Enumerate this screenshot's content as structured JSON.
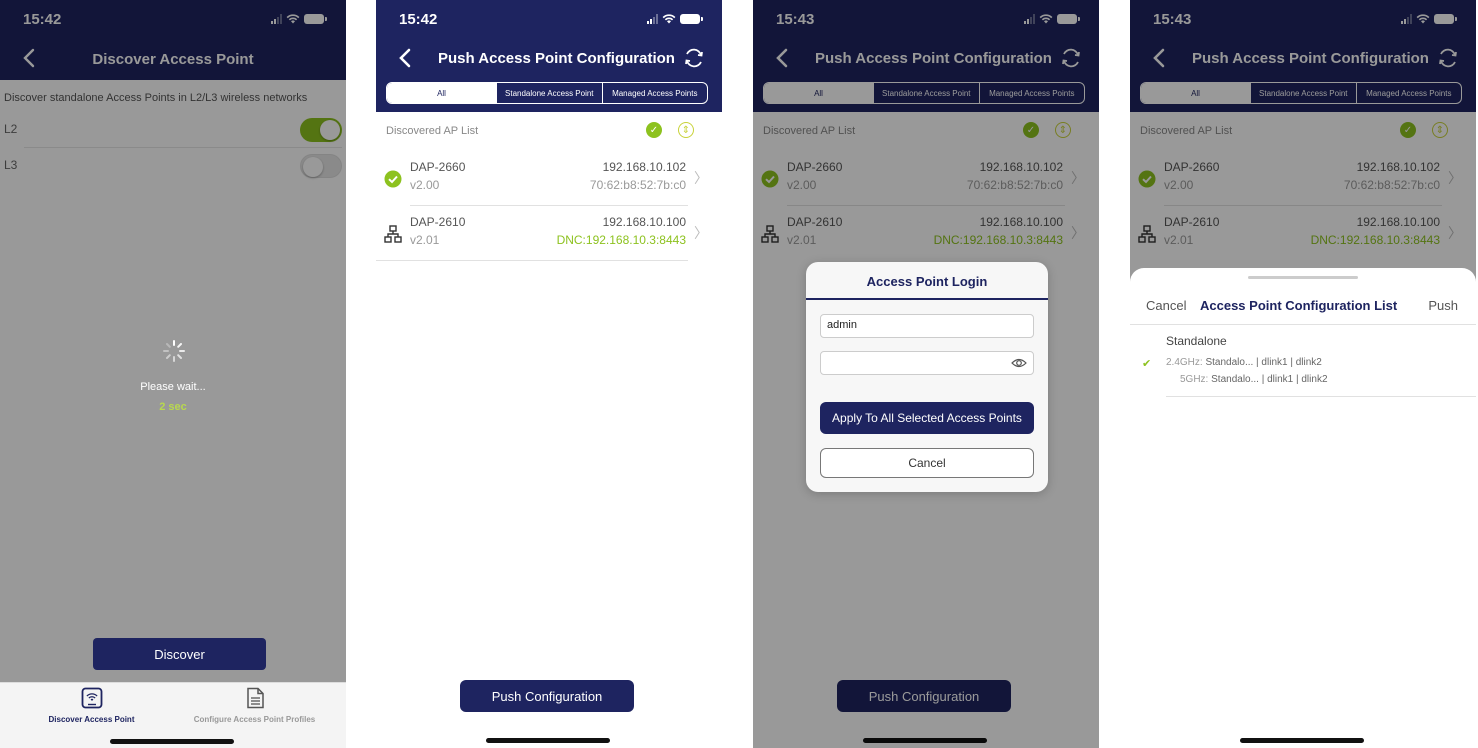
{
  "colors": {
    "navy": "#1e2460",
    "green": "#8dc21f",
    "gray_text": "#999999"
  },
  "screen1": {
    "time": "15:42",
    "title": "Discover Access Point",
    "description": "Discover standalone Access Points in L2/L3 wireless networks",
    "rows": [
      {
        "label": "L2",
        "on": true
      },
      {
        "label": "L3",
        "on": false
      }
    ],
    "wait_text": "Please wait...",
    "wait_seconds": "2 sec",
    "discover_label": "Discover",
    "tabs": [
      {
        "label": "Discover Access Point",
        "icon": "wifi-tablet-icon"
      },
      {
        "label": "Configure Access Point Profiles",
        "icon": "document-icon"
      }
    ]
  },
  "screen2": {
    "time": "15:42",
    "title": "Push Access Point Configuration",
    "segments": [
      "All",
      "Standalone Access Point",
      "Managed Access Points"
    ],
    "list_header": "Discovered AP List",
    "aps": [
      {
        "name": "DAP-2660",
        "version": "v2.00",
        "ip": "192.168.10.102",
        "detail": "70:62:b8:52:7b:c0",
        "icon": "check-circle-icon",
        "managed": false
      },
      {
        "name": "DAP-2610",
        "version": "v2.01",
        "ip": "192.168.10.100",
        "detail": "DNC:192.168.10.3:8443",
        "icon": "network-icon",
        "managed": true
      }
    ],
    "push_label": "Push Configuration"
  },
  "screen3": {
    "time": "15:43",
    "title": "Push Access Point Configuration",
    "segments": [
      "All",
      "Standalone Access Point",
      "Managed Access Points"
    ],
    "list_header": "Discovered AP List",
    "aps": [
      {
        "name": "DAP-2660",
        "version": "v2.00",
        "ip": "192.168.10.102",
        "detail": "70:62:b8:52:7b:c0"
      },
      {
        "name": "DAP-2610",
        "version": "v2.01",
        "ip": "192.168.10.100",
        "detail": "DNC:192.168.10.3:8443"
      }
    ],
    "modal": {
      "title": "Access Point  Login",
      "username": "admin",
      "password": "",
      "apply_label": "Apply To All Selected Access Points",
      "cancel_label": "Cancel"
    },
    "push_label": "Push Configuration"
  },
  "screen4": {
    "time": "15:43",
    "title": "Push Access Point Configuration",
    "segments": [
      "All",
      "Standalone Access Point",
      "Managed Access Points"
    ],
    "list_header": "Discovered AP List",
    "aps": [
      {
        "name": "DAP-2660",
        "version": "v2.00",
        "ip": "192.168.10.102",
        "detail": "70:62:b8:52:7b:c0"
      },
      {
        "name": "DAP-2610",
        "version": "v2.01",
        "ip": "192.168.10.100",
        "detail": "DNC:192.168.10.3:8443"
      }
    ],
    "sheet": {
      "cancel_label": "Cancel",
      "title": "Access Point Configuration List",
      "push_label": "Push",
      "group": "Standalone",
      "line1_key": "2.4GHz:",
      "line1_val": "Standalo... | dlink1 | dlink2",
      "line2_key": "5GHz:",
      "line2_val": "Standalo... | dlink1 | dlink2"
    }
  }
}
